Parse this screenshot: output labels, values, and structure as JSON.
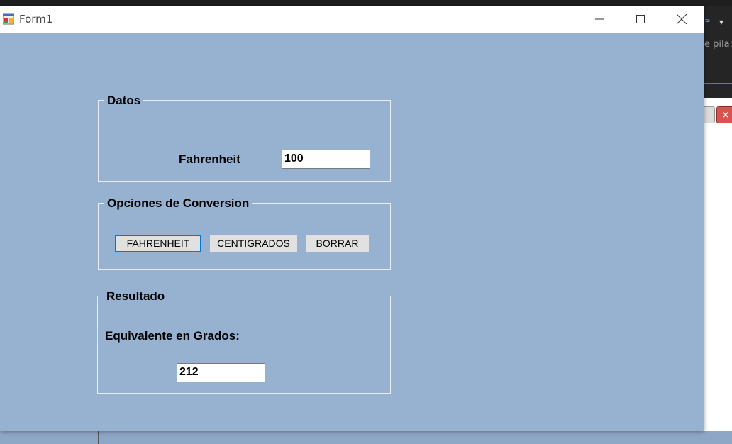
{
  "window": {
    "title": "Form1"
  },
  "background": {
    "right_text": "e pila:",
    "mini_close": "✕"
  },
  "datos": {
    "title": "Datos",
    "fahrenheit_label": "Fahrenheit",
    "fahrenheit_value": "100"
  },
  "opciones": {
    "title": "Opciones de Conversion",
    "buttons": {
      "fahrenheit": "FAHRENHEIT",
      "centigrados": "CENTIGRADOS",
      "borrar": "BORRAR"
    }
  },
  "resultado": {
    "title": "Resultado",
    "equivalente_label": "Equivalente en Grados:",
    "value": "212"
  },
  "colors": {
    "form_bg": "#97b1d1",
    "focus_border": "#0078d7"
  },
  "icons": {
    "app": "winforms-app-icon",
    "minimize": "minimize-icon",
    "maximize": "maximize-icon",
    "close": "close-icon"
  }
}
